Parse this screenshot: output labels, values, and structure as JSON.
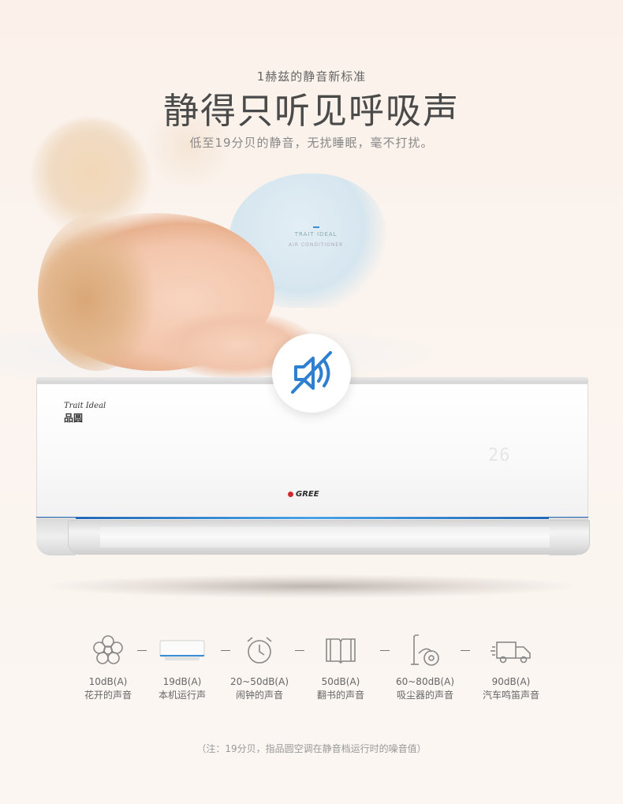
{
  "hero": {
    "kicker": "1赫兹的静音新标准",
    "headline": "静得只听见呼吸声",
    "subline": "低至19分贝的静音，无扰睡眠，毫不打扰。"
  },
  "product": {
    "tag_title": "TRAIT IDEAL",
    "tag_sub": "AIR CONDITIONER",
    "logo_en": "Trait Ideal",
    "logo_cn": "品圆",
    "display_value": "26",
    "maker": "GREE"
  },
  "mute_icon": "mute-speaker-icon",
  "compare": [
    {
      "icon": "flower-icon",
      "value": "10dB(A)",
      "label": "花开的声音"
    },
    {
      "icon": "air-conditioner-icon",
      "value": "19dB(A)",
      "label": "本机运行声"
    },
    {
      "icon": "alarm-clock-icon",
      "value": "20~50dB(A)",
      "label": "闹钟的声音"
    },
    {
      "icon": "book-icon",
      "value": "50dB(A)",
      "label": "翻书的声音"
    },
    {
      "icon": "vacuum-cleaner-icon",
      "value": "60~80dB(A)",
      "label": "吸尘器的声音"
    },
    {
      "icon": "truck-icon",
      "value": "90dB(A)",
      "label": "汽车鸣笛声音"
    }
  ],
  "note": "（注：19分贝，指品圆空调在静音档运行时的噪音值）",
  "colors": {
    "accent": "#2f7fd1",
    "text": "#4a4a4a",
    "background": "#fbf4ef"
  }
}
